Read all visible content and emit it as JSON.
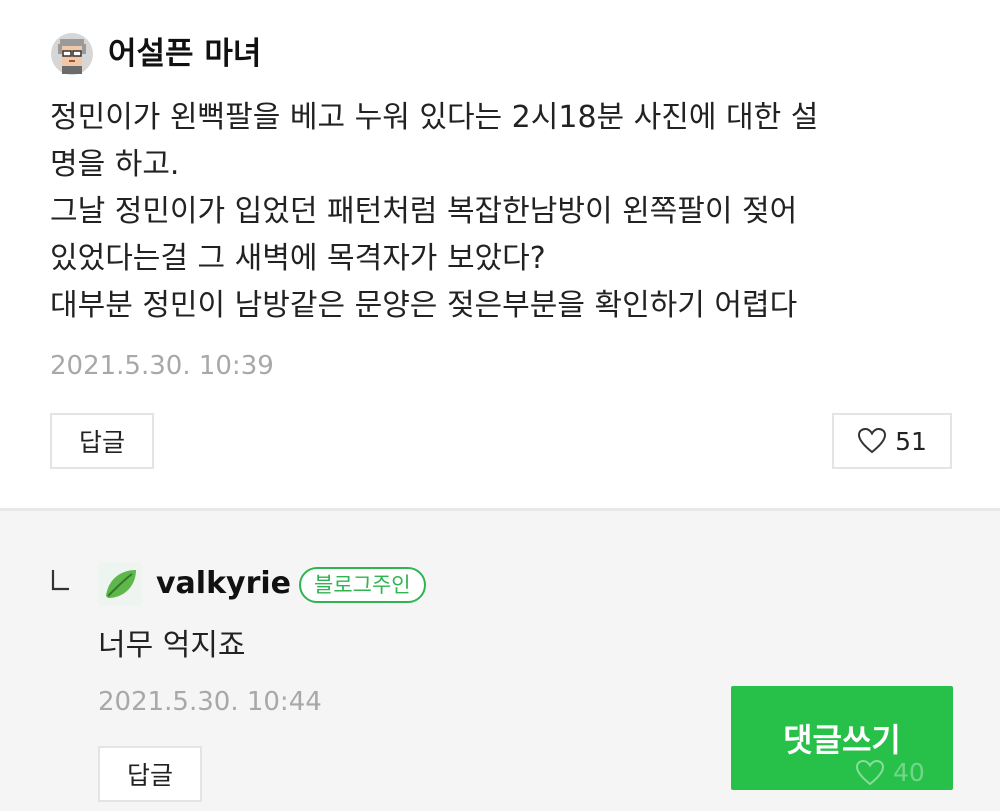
{
  "top_comment": {
    "author": "어설픈 마녀",
    "avatar_icon": "pixel-person-icon",
    "lines": [
      "정민이가 왼뻑팔을 베고 누워 있다는 2시18분 사진에 대한 설",
      "명을 하고.",
      "그날 정민이가 입었던 패턴처럼 복잡한남방이 왼쪽팔이 젖어",
      "있었다는걸 그 새벽에 목격자가 보았다?",
      "대부분 정민이 남방같은 문양은 젖은부분을 확인하기 어렵다"
    ],
    "date": "2021.5.30. 10:39",
    "reply_label": "답글",
    "like_icon": "heart-outline-icon",
    "like_count": "51"
  },
  "reply_comment": {
    "reply_indicator_icon": "reply-corner-arrow-icon",
    "author": "valkyrie",
    "avatar_icon": "green-leaf-icon",
    "badge": "블로그주인",
    "text": "너무 억지죠",
    "date": "2021.5.30. 10:44",
    "reply_label": "답글",
    "like_icon": "heart-outline-icon",
    "like_count": "40"
  },
  "write_button_label": "댓글쓰기",
  "colors": {
    "accent_green": "#27c14a",
    "badge_green": "#2fb451",
    "date_gray": "#a8a8a8",
    "reply_bg": "#f5f5f5"
  }
}
